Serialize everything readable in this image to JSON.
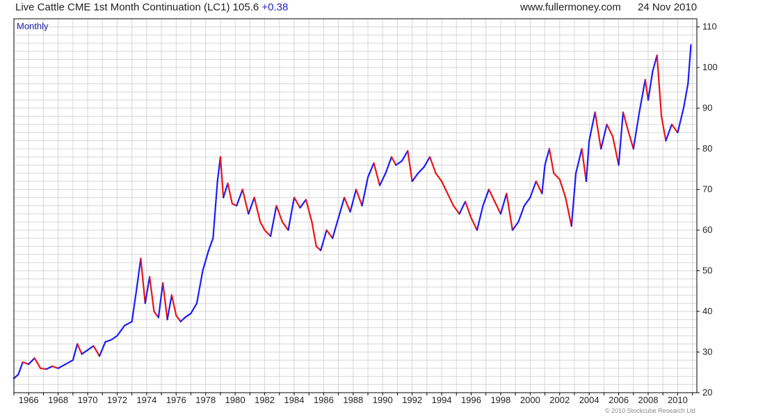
{
  "header": {
    "title": "Live Cattle CME 1st Month Continuation (LC1) 105.6",
    "change": "+0.38",
    "site": "www.fullermoney.com",
    "date": "24 Nov 2010"
  },
  "footer": {
    "copyright": "© 2010 Stockcube Research Ltd"
  },
  "colors": {
    "up": "#1a1aff",
    "down": "#ee1111",
    "grid": "#d6d6d6",
    "axis": "#000000"
  },
  "chart_data": {
    "type": "line",
    "period_label": "Monthly",
    "y_axis_side": "right",
    "grid": true,
    "xlim": [
      1965.0,
      2011.3
    ],
    "ylim": [
      20,
      112
    ],
    "x_ticks": [
      "1966",
      "1968",
      "1970",
      "1972",
      "1974",
      "1976",
      "1978",
      "1980",
      "1982",
      "1984",
      "1986",
      "1988",
      "1990",
      "1992",
      "1994",
      "1996",
      "1998",
      "2000",
      "2002",
      "2004",
      "2006",
      "2008",
      "2010"
    ],
    "y_ticks": [
      20,
      30,
      40,
      50,
      60,
      70,
      80,
      90,
      100,
      110
    ],
    "series": [
      {
        "x": [
          1965.0,
          1965.3,
          1965.6,
          1966.0,
          1966.4,
          1966.8,
          1967.2,
          1967.6,
          1968.0,
          1968.5,
          1969.0,
          1969.3,
          1969.6,
          1970.0,
          1970.4,
          1970.8,
          1971.2,
          1971.6,
          1972.0,
          1972.5,
          1973.0,
          1973.3,
          1973.6,
          1973.9,
          1974.2,
          1974.5,
          1974.8,
          1975.1,
          1975.4,
          1975.7,
          1976.0,
          1976.3,
          1976.6,
          1977.0,
          1977.4,
          1977.8,
          1978.2,
          1978.5,
          1978.8,
          1979.0,
          1979.2,
          1979.5,
          1979.8,
          1980.1,
          1980.5,
          1980.9,
          1981.3,
          1981.7,
          1982.0,
          1982.4,
          1982.8,
          1983.2,
          1983.6,
          1984.0,
          1984.4,
          1984.8,
          1985.2,
          1985.5,
          1985.8,
          1986.2,
          1986.6,
          1987.0,
          1987.4,
          1987.8,
          1988.2,
          1988.6,
          1989.0,
          1989.4,
          1989.8,
          1990.2,
          1990.6,
          1990.9,
          1991.3,
          1991.7,
          1992.0,
          1992.4,
          1992.8,
          1993.2,
          1993.6,
          1994.0,
          1994.4,
          1994.8,
          1995.2,
          1995.6,
          1996.0,
          1996.4,
          1996.8,
          1997.2,
          1997.6,
          1998.0,
          1998.4,
          1998.8,
          1999.2,
          1999.6,
          2000.0,
          2000.4,
          2000.8,
          2001.0,
          2001.3,
          2001.6,
          2002.0,
          2002.4,
          2002.8,
          2003.1,
          2003.5,
          2003.8,
          2004.0,
          2004.4,
          2004.8,
          2005.2,
          2005.6,
          2006.0,
          2006.3,
          2006.6,
          2007.0,
          2007.4,
          2007.8,
          2008.0,
          2008.3,
          2008.6,
          2008.9,
          2009.2,
          2009.6,
          2010.0,
          2010.4,
          2010.7,
          2010.9
        ],
        "values": [
          23.5,
          24.5,
          27.5,
          27.0,
          28.5,
          26.0,
          25.8,
          26.5,
          26.0,
          27.0,
          28.0,
          32.0,
          29.5,
          30.5,
          31.5,
          29.0,
          32.5,
          33.0,
          34.0,
          36.5,
          37.5,
          45.0,
          53.0,
          42.0,
          48.5,
          40.0,
          38.5,
          47.0,
          38.0,
          44.0,
          39.0,
          37.5,
          38.5,
          39.5,
          42.0,
          50.0,
          55.0,
          58.0,
          72.0,
          78.0,
          68.0,
          71.5,
          66.5,
          66.0,
          70.0,
          64.0,
          68.0,
          62.0,
          60.0,
          58.5,
          66.0,
          62.0,
          60.0,
          68.0,
          65.5,
          67.5,
          62.0,
          56.0,
          55.0,
          60.0,
          58.0,
          63.0,
          68.0,
          64.5,
          70.0,
          66.0,
          73.0,
          76.5,
          71.0,
          74.0,
          78.0,
          76.0,
          77.0,
          79.5,
          72.0,
          74.0,
          75.5,
          78.0,
          74.0,
          72.0,
          69.0,
          66.0,
          64.0,
          67.0,
          63.0,
          60.0,
          66.0,
          70.0,
          67.0,
          64.0,
          69.0,
          60.0,
          62.0,
          66.0,
          68.0,
          72.0,
          69.0,
          76.0,
          80.0,
          74.0,
          72.5,
          68.0,
          61.0,
          74.0,
          80.0,
          72.0,
          82.0,
          89.0,
          80.0,
          86.0,
          83.0,
          76.0,
          89.0,
          85.0,
          80.0,
          89.0,
          97.0,
          92.0,
          99.0,
          103.0,
          88.0,
          82.0,
          86.0,
          84.0,
          90.0,
          96.0,
          105.6
        ]
      }
    ]
  }
}
